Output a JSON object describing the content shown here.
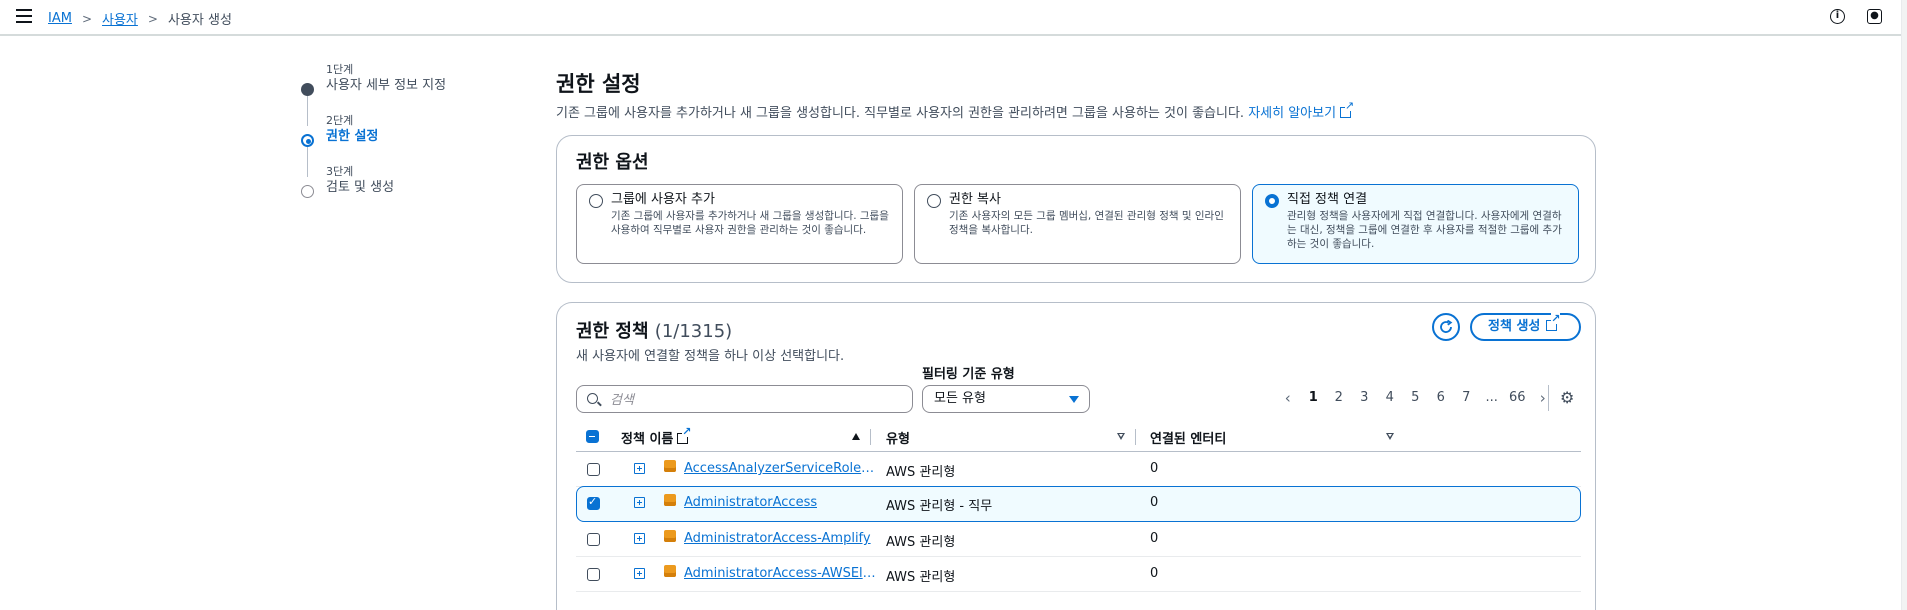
{
  "breadcrumb": {
    "root": "IAM",
    "users": "사용자",
    "current": "사용자 생성"
  },
  "steps": [
    {
      "num": "1단계",
      "label": "사용자 세부 정보 지정",
      "state": "done"
    },
    {
      "num": "2단계",
      "label": "권한 설정",
      "state": "active"
    },
    {
      "num": "3단계",
      "label": "검토 및 생성",
      "state": "todo"
    }
  ],
  "header": {
    "title": "권한 설정",
    "description": "기존 그룹에 사용자를 추가하거나 새 그룹을 생성합니다. 직무별로 사용자의 권한을 관리하려면 그룹을 사용하는 것이 좋습니다.",
    "learn_more": "자세히 알아보기"
  },
  "options": {
    "title": "권한 옵션",
    "tiles": [
      {
        "title": "그룹에 사용자 추가",
        "desc": "기존 그룹에 사용자를 추가하거나 새 그룹을 생성합니다. 그룹을 사용하여 직무별로 사용자 권한을 관리하는 것이 좋습니다.",
        "selected": false
      },
      {
        "title": "권한 복사",
        "desc": "기존 사용자의 모든 그룹 멤버십, 연결된 관리형 정책 및 인라인 정책을 복사합니다.",
        "selected": false
      },
      {
        "title": "직접 정책 연결",
        "desc": "관리형 정책을 사용자에게 직접 연결합니다. 사용자에게 연결하는 대신, 정책을 그룹에 연결한 후 사용자를 적절한 그룹에 추가하는 것이 좋습니다.",
        "selected": true
      }
    ]
  },
  "policies": {
    "title": "권한 정책",
    "count": "(1/1315)",
    "description": "새 사용자에 연결할 정책을 하나 이상 선택합니다.",
    "create_button": "정책 생성",
    "filter_label": "필터링 기준 유형",
    "search_placeholder": "검색",
    "filter_value": "모든 유형",
    "pages": [
      "1",
      "2",
      "3",
      "4",
      "5",
      "6",
      "7",
      "...",
      "66"
    ],
    "columns": {
      "name": "정책 이름",
      "type": "유형",
      "entities": "연결된 엔터티"
    },
    "rows": [
      {
        "name": "AccessAnalyzerServiceRolePolicy",
        "type": "AWS 관리형",
        "entities": "0",
        "checked": false
      },
      {
        "name": "AdministratorAccess",
        "type": "AWS 관리형 - 직무",
        "entities": "0",
        "checked": true
      },
      {
        "name": "AdministratorAccess-Amplify",
        "type": "AWS 관리형",
        "entities": "0",
        "checked": false
      },
      {
        "name": "AdministratorAccess-AWSElasticBeanstalk",
        "type": "AWS 관리형",
        "entities": "0",
        "checked": false
      }
    ]
  },
  "colors": {
    "accent": "#0972d3",
    "selected_bg": "#f0fbff",
    "aws_orange": "#ec9a1e"
  }
}
